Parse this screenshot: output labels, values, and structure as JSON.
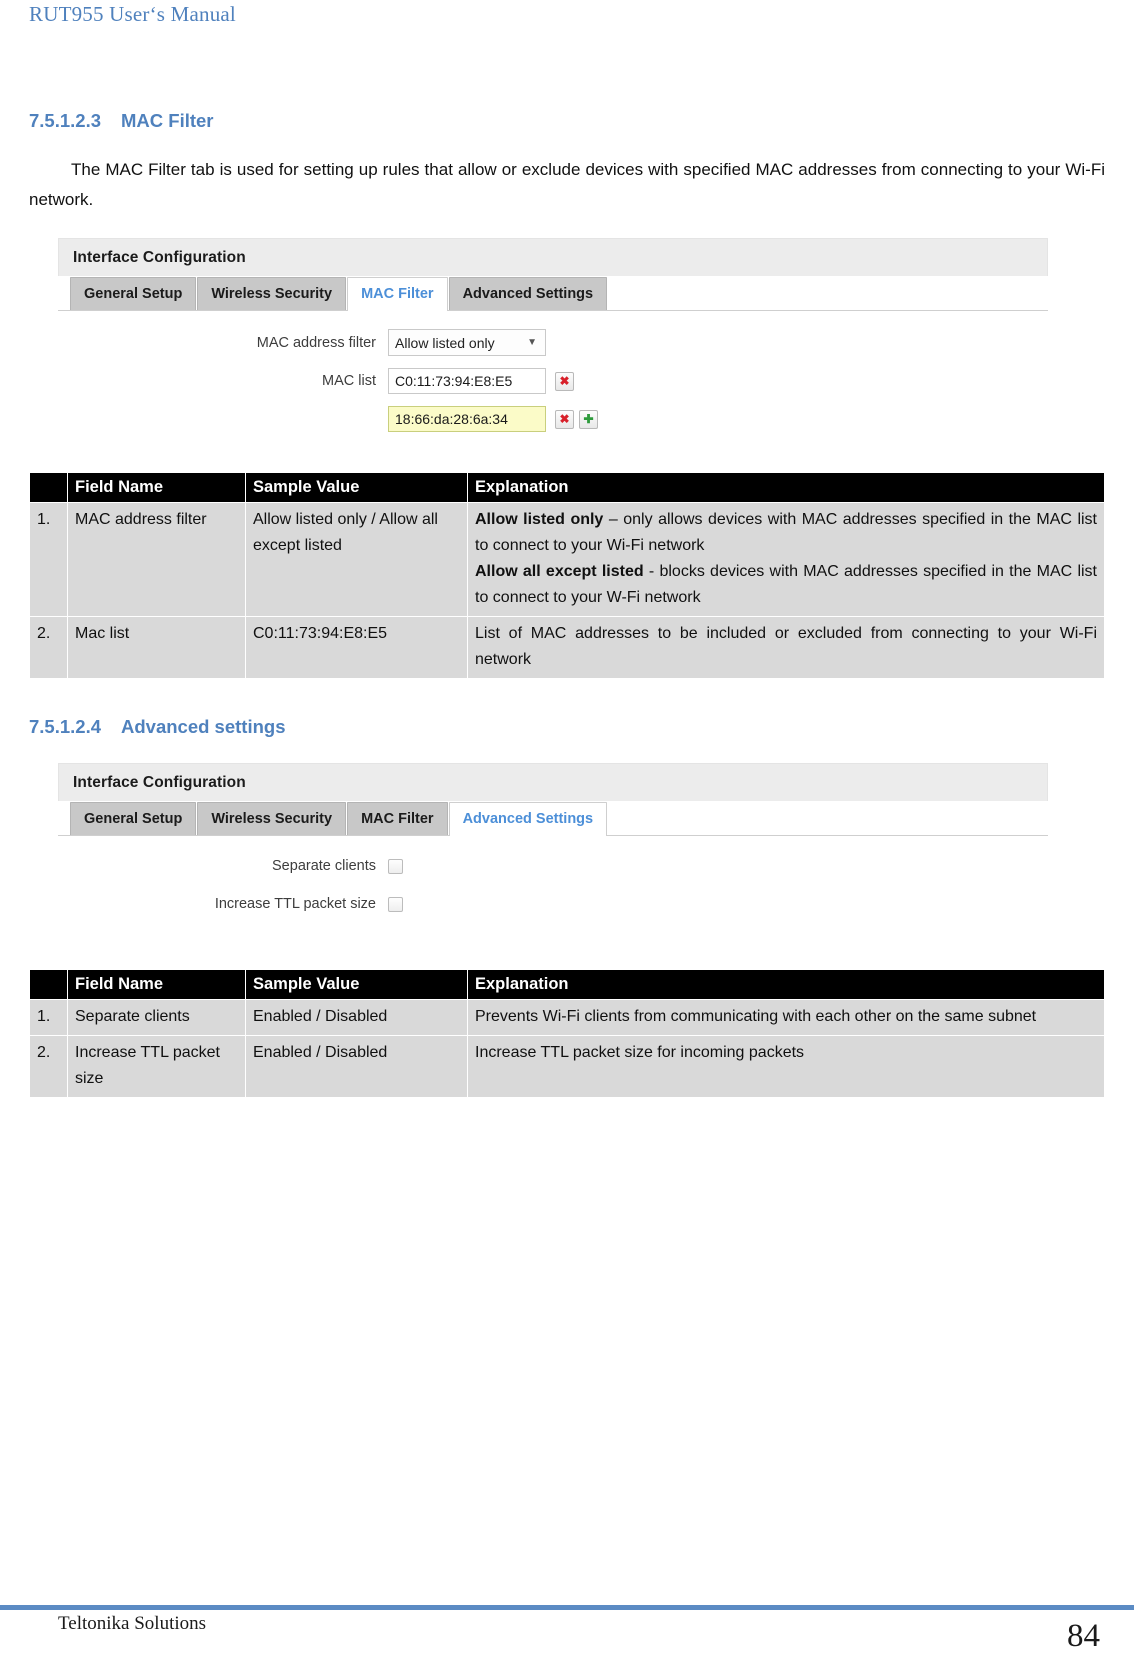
{
  "document": {
    "running_header": "RUT955 User‘s Manual",
    "footer_company": "Teltonika Solutions",
    "page_number": "84",
    "accent_color": "#4f81bd",
    "footer_rule_color": "#5b8bc4"
  },
  "sections": [
    {
      "number": "7.5.1.2.3",
      "title": "MAC Filter",
      "paragraph": "The MAC Filter tab is used for setting up rules that allow or exclude devices with specified MAC addresses from connecting to your Wi-Fi network."
    },
    {
      "number": "7.5.1.2.4",
      "title": "Advanced settings"
    }
  ],
  "mac_filter_screenshot": {
    "panel_title": "Interface Configuration",
    "tabs": [
      {
        "label": "General Setup",
        "active": false
      },
      {
        "label": "Wireless Security",
        "active": false
      },
      {
        "label": "MAC Filter",
        "active": true
      },
      {
        "label": "Advanced Settings",
        "active": false
      }
    ],
    "fields": {
      "mac_address_filter_label": "MAC address filter",
      "mac_address_filter_value": "Allow listed only",
      "mac_list_label": "MAC list",
      "mac_list_row1_value": "C0:11:73:94:E8:E5",
      "mac_list_row2_value": "18:66:da:28:6a:34",
      "remove_glyph": "✖",
      "add_glyph": "✚",
      "caret_glyph": "▼"
    }
  },
  "advanced_settings_screenshot": {
    "panel_title": "Interface Configuration",
    "tabs": [
      {
        "label": "General Setup",
        "active": false
      },
      {
        "label": "Wireless Security",
        "active": false
      },
      {
        "label": "MAC Filter",
        "active": false
      },
      {
        "label": "Advanced Settings",
        "active": true
      }
    ],
    "fields": {
      "separate_clients_label": "Separate clients",
      "separate_clients_checked": false,
      "increase_ttl_label": "Increase TTL packet size",
      "increase_ttl_checked": false
    }
  },
  "tables": [
    {
      "id": "mac-filter-table",
      "headers": [
        "",
        "Field Name",
        "Sample Value",
        "Explanation"
      ],
      "rows": [
        {
          "num": "1.",
          "field": "MAC address filter",
          "value": "Allow listed only / Allow all except listed",
          "explanation_parts": [
            {
              "bold": "Allow listed only",
              "text": " – only allows devices with MAC addresses specified in the MAC list to connect to your Wi-Fi network"
            },
            {
              "bold": "Allow all except listed",
              "text": " -  blocks devices with MAC addresses specified in the MAC list to connect to your W-Fi network"
            }
          ]
        },
        {
          "num": "2.",
          "field": "Mac list",
          "value": "C0:11:73:94:E8:E5",
          "explanation_parts": [
            {
              "bold": "",
              "text": "List of MAC addresses to be included or excluded from connecting to your Wi-Fi network"
            }
          ]
        }
      ]
    },
    {
      "id": "advanced-settings-table",
      "headers": [
        "",
        "Field Name",
        "Sample Value",
        "Explanation"
      ],
      "rows": [
        {
          "num": "1.",
          "field": "Separate clients",
          "value": "Enabled / Disabled",
          "explanation_parts": [
            {
              "bold": "",
              "text": "Prevents Wi-Fi clients from communicating with each other on the same subnet"
            }
          ]
        },
        {
          "num": "2.",
          "field": "Increase TTL packet size",
          "value": "Enabled / Disabled",
          "explanation_parts": [
            {
              "bold": "",
              "text": "Increase TTL packet size for incoming packets"
            }
          ]
        }
      ]
    }
  ]
}
